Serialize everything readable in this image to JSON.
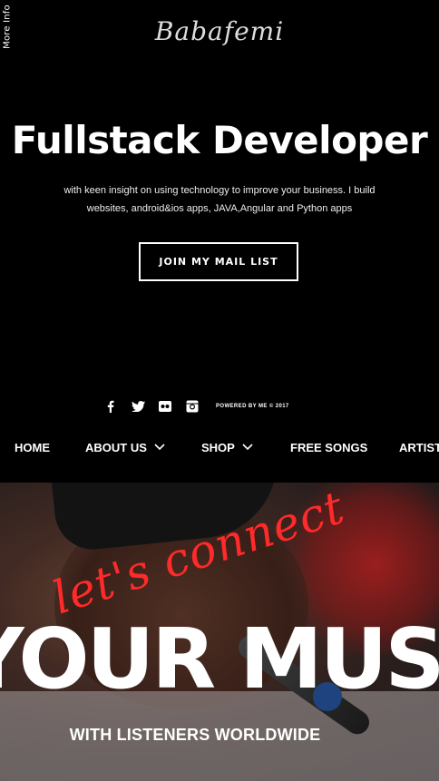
{
  "header": {
    "more_info": "More Info",
    "logo": "Babafemi",
    "headline": "Fullstack Developer",
    "subtext": "with keen insight on using technology to improve your business. I build websites, android&ios apps, JAVA,Angular and Python apps",
    "join_button": "JOIN MY MAIL LIST"
  },
  "social": {
    "icons": [
      "facebook-icon",
      "twitter-icon",
      "flickr-icon",
      "instagram-icon"
    ],
    "powered_by": "POWERED BY ME © 2017"
  },
  "nav": {
    "items": [
      {
        "label": "HOME",
        "has_dropdown": false
      },
      {
        "label": "ABOUT US",
        "has_dropdown": true
      },
      {
        "label": "SHOP",
        "has_dropdown": true
      },
      {
        "label": "FREE SONGS",
        "has_dropdown": false
      },
      {
        "label": "ARTIST",
        "has_dropdown": false
      }
    ]
  },
  "hero": {
    "script_text": "let's connect",
    "big_text": "YOUR MUSIC",
    "tagline": "WITH LISTENERS WORLDWIDE",
    "accent_color": "#ff2a2a"
  }
}
